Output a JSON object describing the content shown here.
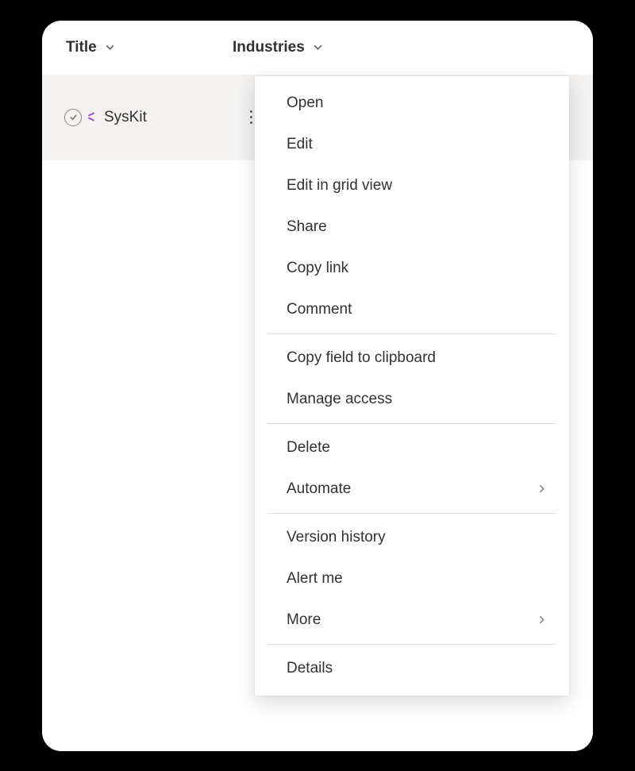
{
  "columns": {
    "title": "Title",
    "industries": "Industries"
  },
  "row": {
    "title": "SysKit"
  },
  "menu": {
    "groups": [
      {
        "items": [
          {
            "label": "Open",
            "submenu": false
          },
          {
            "label": "Edit",
            "submenu": false
          },
          {
            "label": "Edit in grid view",
            "submenu": false
          },
          {
            "label": "Share",
            "submenu": false
          },
          {
            "label": "Copy link",
            "submenu": false
          },
          {
            "label": "Comment",
            "submenu": false
          }
        ]
      },
      {
        "items": [
          {
            "label": "Copy field to clipboard",
            "submenu": false
          },
          {
            "label": "Manage access",
            "submenu": false
          }
        ]
      },
      {
        "items": [
          {
            "label": "Delete",
            "submenu": false
          },
          {
            "label": "Automate",
            "submenu": true
          }
        ]
      },
      {
        "items": [
          {
            "label": "Version history",
            "submenu": false
          },
          {
            "label": "Alert me",
            "submenu": false
          },
          {
            "label": "More",
            "submenu": true
          }
        ]
      },
      {
        "items": [
          {
            "label": "Details",
            "submenu": false
          }
        ]
      }
    ]
  }
}
